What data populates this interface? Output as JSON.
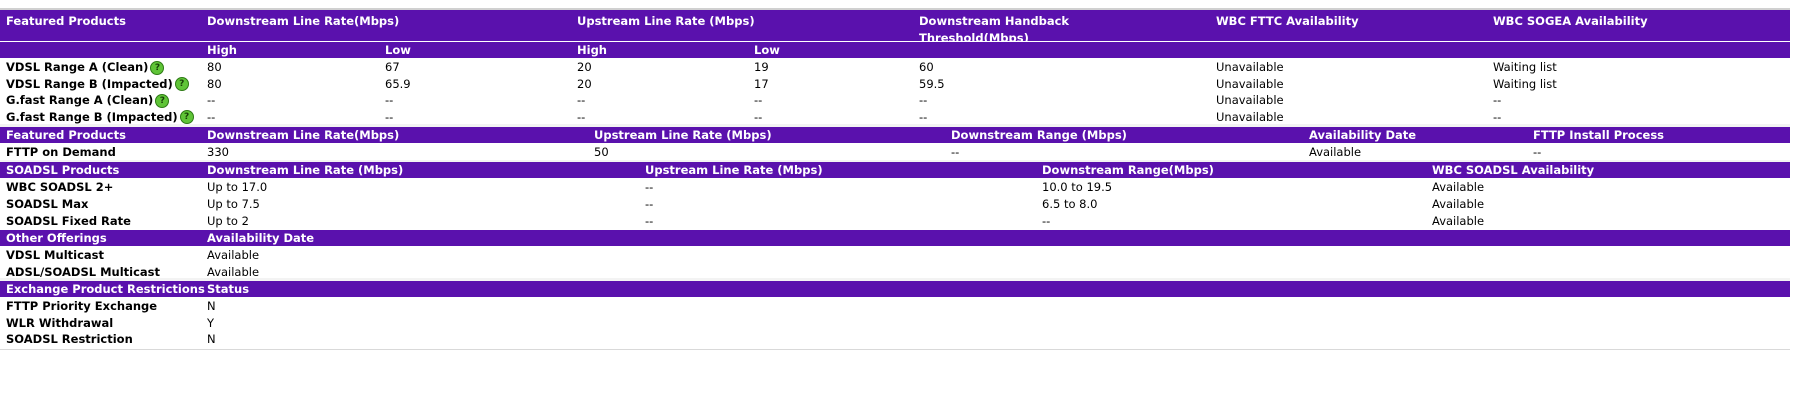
{
  "featured": {
    "headers": {
      "products": "Featured Products",
      "downstream": "Downstream Line Rate(Mbps)",
      "upstream": "Upstream Line Rate (Mbps)",
      "handback_line1": "Downstream Handback",
      "handback_line2": "Threshold(Mbps)",
      "fttc": "WBC FTTC Availability",
      "sogea": "WBC SOGEA Availability",
      "high": "High",
      "low": "Low",
      "up_high": "High",
      "up_low": "Low"
    },
    "rows": [
      {
        "name": "VDSL Range A (Clean)",
        "icon": true,
        "dh": "80",
        "dl": "67",
        "uh": "20",
        "ul": "19",
        "hb": "60",
        "fttc": "Unavailable",
        "sogea": "Waiting list"
      },
      {
        "name": "VDSL Range B (Impacted)",
        "icon": true,
        "dh": "80",
        "dl": "65.9",
        "uh": "20",
        "ul": "17",
        "hb": "59.5",
        "fttc": "Unavailable",
        "sogea": "Waiting list"
      },
      {
        "name": "G.fast Range A (Clean)",
        "icon": true,
        "dh": "--",
        "dl": "--",
        "uh": "--",
        "ul": "--",
        "hb": "--",
        "fttc": "Unavailable",
        "sogea": "--"
      },
      {
        "name": "G.fast Range B (Impacted)",
        "icon": true,
        "dh": "--",
        "dl": "--",
        "uh": "--",
        "ul": "--",
        "hb": "--",
        "fttc": "Unavailable",
        "sogea": "--"
      }
    ]
  },
  "fttp": {
    "headers": {
      "products": "Featured Products",
      "downstream": "Downstream Line Rate(Mbps)",
      "upstream": "Upstream Line Rate (Mbps)",
      "range": "Downstream Range (Mbps)",
      "date": "Availability Date",
      "install": "FTTP Install Process"
    },
    "rows": [
      {
        "name": "FTTP on Demand",
        "down": "330",
        "up": "50",
        "range": "--",
        "date": "Available",
        "install": "--"
      }
    ]
  },
  "soadsl": {
    "headers": {
      "products": "SOADSL Products",
      "downstream": "Downstream Line Rate (Mbps)",
      "upstream": "Upstream Line Rate (Mbps)",
      "range": "Downstream Range(Mbps)",
      "avail": "WBC SOADSL Availability"
    },
    "rows": [
      {
        "name": "WBC SOADSL 2+",
        "down": "Up to 17.0",
        "up": "--",
        "range": "10.0 to 19.5",
        "avail": "Available"
      },
      {
        "name": "SOADSL Max",
        "down": "Up to 7.5",
        "up": "--",
        "range": "6.5 to 8.0",
        "avail": "Available"
      },
      {
        "name": "SOADSL Fixed Rate",
        "down": "Up to 2",
        "up": "--",
        "range": "--",
        "avail": "Available"
      }
    ]
  },
  "other": {
    "headers": {
      "products": "Other Offerings",
      "date": "Availability Date"
    },
    "rows": [
      {
        "name": "VDSL Multicast",
        "date": "Available"
      },
      {
        "name": "ADSL/SOADSL Multicast",
        "date": "Available"
      }
    ]
  },
  "restrictions": {
    "headers": {
      "products": "Exchange Product Restrictions",
      "status": "Status"
    },
    "rows": [
      {
        "name": "FTTP Priority Exchange",
        "status": "N"
      },
      {
        "name": "WLR Withdrawal",
        "status": "Y"
      },
      {
        "name": "SOADSL Restriction",
        "status": "N"
      }
    ]
  },
  "icon_glyph": "?",
  "colors": {
    "header_bg": "#5a11ad",
    "header_text": "#ffffff",
    "help_icon": "#5fc437"
  }
}
